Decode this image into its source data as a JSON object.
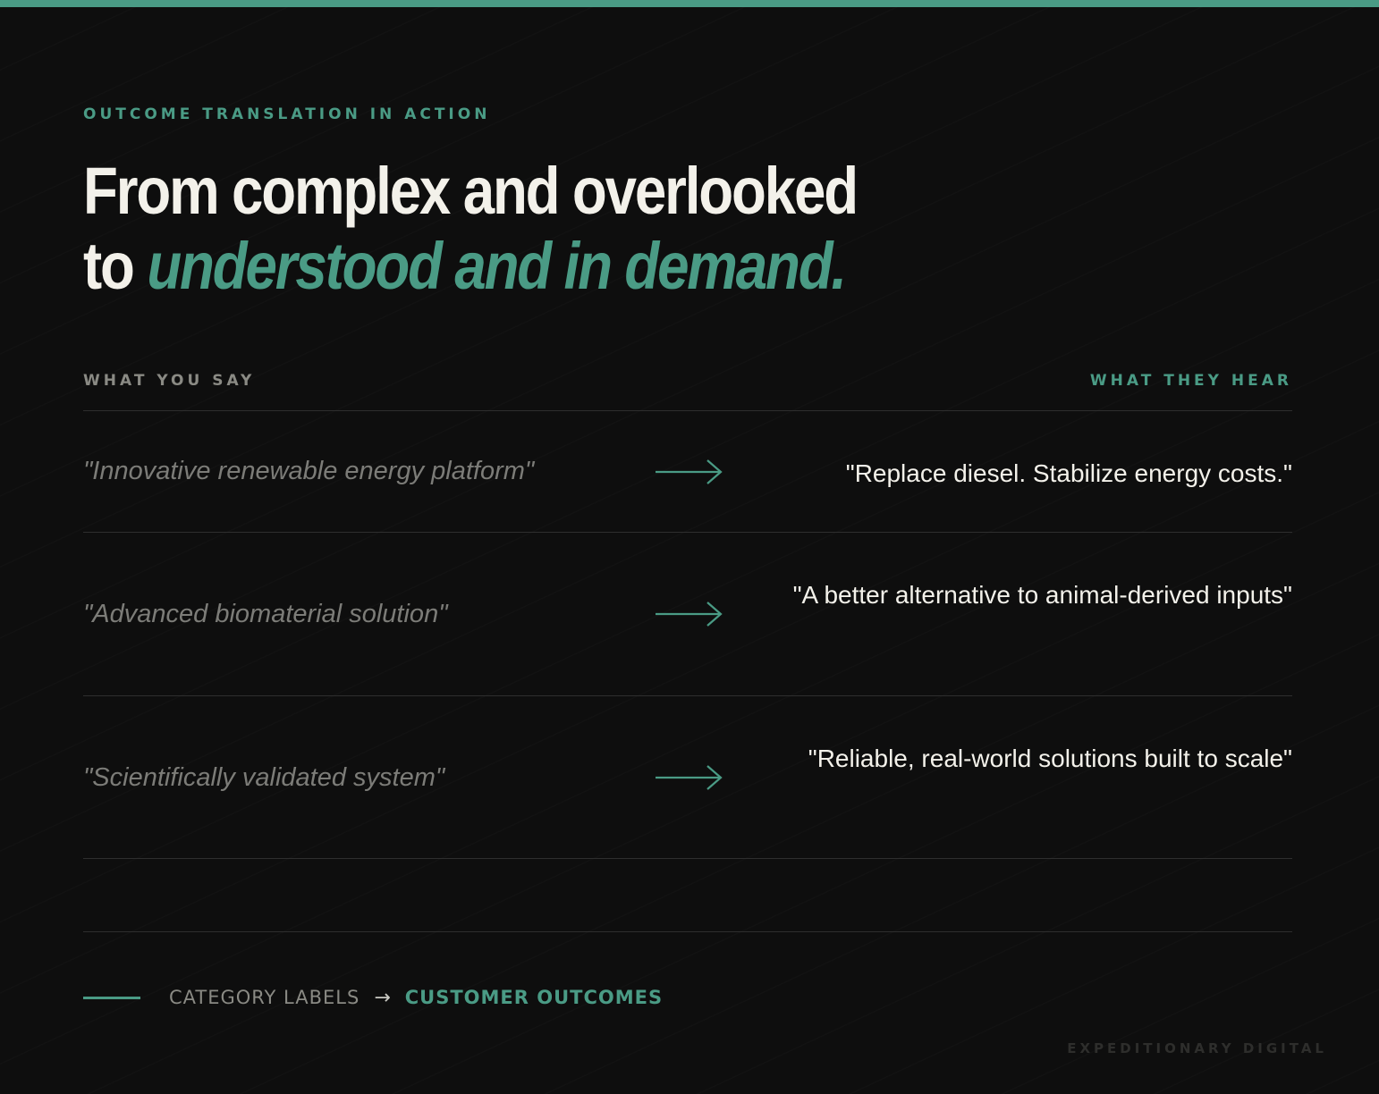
{
  "eyebrow": "OUTCOME TRANSLATION IN ACTION",
  "headline": {
    "line1": "From complex and overlooked",
    "line2_prefix": "to",
    "line2_accent": "understood and in demand."
  },
  "columns": {
    "left_heading": "WHAT YOU SAY",
    "right_heading": "WHAT THEY HEAR"
  },
  "rows": [
    {
      "say": "\"Innovative renewable energy platform\"",
      "hear": "\"Replace diesel. Stabilize energy costs.\""
    },
    {
      "say": "\"Advanced biomaterial solution\"",
      "hear": "\"A better alternative to animal-derived inputs\""
    },
    {
      "say": "\"Scientifically validated system\"",
      "hear": "\"Reliable, real-world solutions built to scale\""
    }
  ],
  "legend": {
    "from": "CATEGORY LABELS",
    "arrow": "→",
    "to": "CUSTOMER OUTCOMES"
  },
  "brand": "EXPEDITIONARY DIGITAL",
  "colors": {
    "background": "#0e0e0e",
    "accent": "#4a9b85",
    "text": "#f3f1ea",
    "muted": "#7c7c78"
  },
  "icons": {
    "row_arrow": "arrow-right-icon"
  }
}
